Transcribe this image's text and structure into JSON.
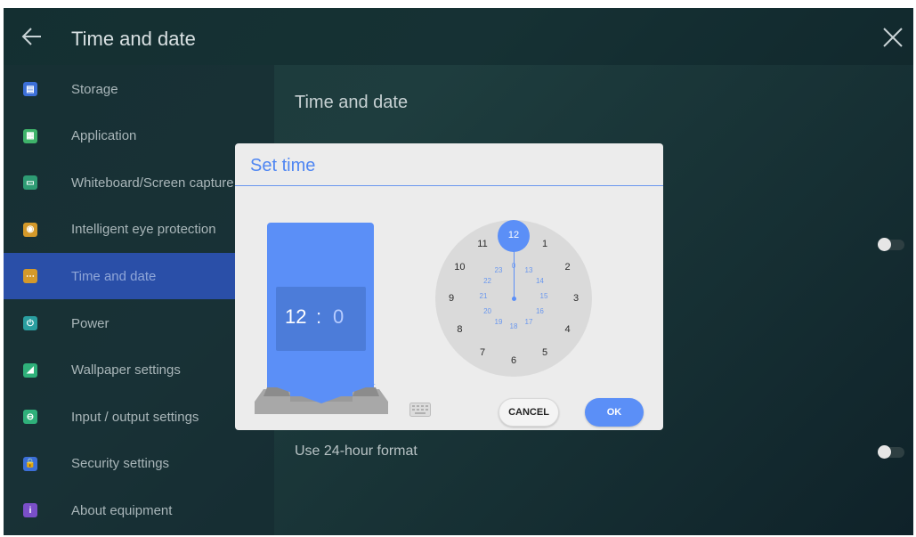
{
  "header": {
    "title": "Time and date"
  },
  "sidebar": {
    "items": [
      {
        "label": "Storage",
        "icon": "storage-icon",
        "color": "#3c6fd8",
        "glyph": "▤"
      },
      {
        "label": "Application",
        "icon": "apps-icon",
        "color": "#3fb36a",
        "glyph": "▦"
      },
      {
        "label": "Whiteboard/Screen capture",
        "icon": "whiteboard-icon",
        "color": "#2e9c74",
        "glyph": "▭"
      },
      {
        "label": "Intelligent eye protection",
        "icon": "eye-icon",
        "color": "#d4992a",
        "glyph": "◉"
      },
      {
        "label": "Time and date",
        "icon": "calendar-icon",
        "color": "#d4992a",
        "glyph": "⋯",
        "active": true
      },
      {
        "label": "Power",
        "icon": "power-icon",
        "color": "#2a9ea0",
        "glyph": "⏻"
      },
      {
        "label": "Wallpaper settings",
        "icon": "wallpaper-icon",
        "color": "#2fb07a",
        "glyph": "◢"
      },
      {
        "label": "Input / output settings",
        "icon": "input-output-icon",
        "color": "#2fb07a",
        "glyph": "⊖"
      },
      {
        "label": "Security settings",
        "icon": "lock-icon",
        "color": "#3c6fd8",
        "glyph": "🔒"
      },
      {
        "label": "About equipment",
        "icon": "info-icon",
        "color": "#7a4fc8",
        "glyph": "i"
      }
    ]
  },
  "content": {
    "title": "Time and date",
    "use_24_hour_label": "Use 24-hour format"
  },
  "dialog": {
    "title": "Set time",
    "hour": "12",
    "separator": ":",
    "minute": "0",
    "selected": "12",
    "outer_numbers": [
      "12",
      "1",
      "2",
      "3",
      "4",
      "5",
      "6",
      "7",
      "8",
      "9",
      "10",
      "11"
    ],
    "inner_numbers": [
      "0",
      "13",
      "14",
      "15",
      "16",
      "17",
      "18",
      "19",
      "20",
      "21",
      "22",
      "23"
    ],
    "cancel_label": "CANCEL",
    "ok_label": "OK"
  },
  "colors": {
    "accent": "#5b8ff7",
    "active_nav": "#2a4fa8"
  }
}
